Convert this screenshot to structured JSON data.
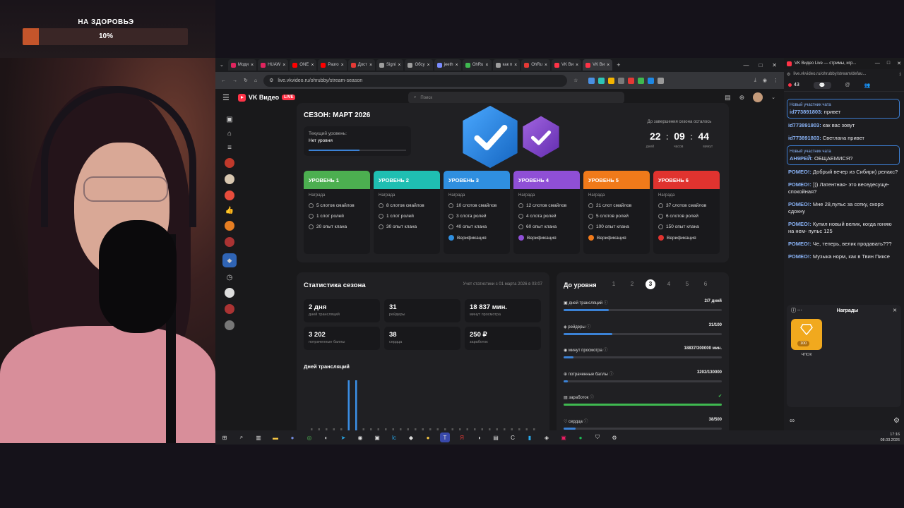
{
  "overlay": {
    "goal_title": "НА ЗДОРОВЬЭ",
    "goal_percent": "10%",
    "goal_progress": 0.1
  },
  "browser": {
    "tabs": [
      {
        "label": "Моди",
        "color": "#e0245e"
      },
      {
        "label": "HUAW",
        "color": "#e0245e"
      },
      {
        "label": "ONE",
        "color": "#ff0000"
      },
      {
        "label": "Разго",
        "color": "#ff0000"
      },
      {
        "label": "Дост",
        "color": "#e53935"
      },
      {
        "label": "Signi",
        "color": "#9e9e9e"
      },
      {
        "label": "Обсу",
        "color": "#9e9e9e"
      },
      {
        "label": "jeeth",
        "color": "#7a8cff"
      },
      {
        "label": "OhRu",
        "color": "#3fb950"
      },
      {
        "label": "как п",
        "color": "#9e9e9e"
      },
      {
        "label": "OhRu",
        "color": "#e53935"
      },
      {
        "label": "VK Ви",
        "color": "#ff3347"
      },
      {
        "label": "VK Ви",
        "color": "#ff3347"
      }
    ],
    "url": "live.vkvideo.ru/ohrubby/stream-season"
  },
  "site": {
    "logo": "VK Видео",
    "live_badge": "LIVE",
    "search_placeholder": "Поиск",
    "season": {
      "title": "СЕЗОН: МАРТ 2026",
      "current_level_label": "Текущий уровень:",
      "current_level_value": "Нет уровня",
      "current_level_progress": 0.52,
      "timer_label": "До завершения сезона осталось",
      "days": "22",
      "hours": "09",
      "minutes": "44",
      "days_unit": "дней",
      "hours_unit": "часов",
      "minutes_unit": "минут",
      "levels": [
        {
          "name": "УРОВЕНЬ 1",
          "color": "#4caf50",
          "reward_label": "Награда",
          "smiles": "5 слотов смайлов",
          "roles": "1 слот ролей",
          "xp": "20 опыт клана",
          "verify": ""
        },
        {
          "name": "УРОВЕНЬ 2",
          "color": "#1fbfb2",
          "reward_label": "Награда",
          "smiles": "8 слотов смайлов",
          "roles": "1 слот ролей",
          "xp": "30 опыт клана",
          "verify": ""
        },
        {
          "name": "УРОВЕНЬ 3",
          "color": "#2f8fe0",
          "reward_label": "Награда",
          "smiles": "10 слотов смайлов",
          "roles": "3 слота ролей",
          "xp": "40 опыт клана",
          "verify": "Верификация",
          "verify_color": "#2f8fe0"
        },
        {
          "name": "УРОВЕНЬ 4",
          "color": "#8f4fd6",
          "reward_label": "Награда",
          "smiles": "12 слотов смайлов",
          "roles": "4 слота ролей",
          "xp": "60 опыт клана",
          "verify": "Верификация",
          "verify_color": "#8f4fd6"
        },
        {
          "name": "УРОВЕНЬ 5",
          "color": "#f07a1a",
          "reward_label": "Награда",
          "smiles": "21 слот смайлов",
          "roles": "5 слотов ролей",
          "xp": "100 опыт клана",
          "verify": "Верификация",
          "verify_color": "#f07a1a"
        },
        {
          "name": "УРОВЕНЬ 6",
          "color": "#e0332f",
          "reward_label": "Награда",
          "smiles": "37 слотов смайлов",
          "roles": "6 слотов ролей",
          "xp": "150 опыт клана",
          "verify": "Верификация",
          "verify_color": "#e0332f"
        }
      ]
    },
    "stats": {
      "title": "Статистика сезона",
      "subtitle": "Учет статистики с 01 марта 2026 в 03:07",
      "tiles": [
        {
          "value": "2 дня",
          "label": "дней трансляций"
        },
        {
          "value": "31",
          "label": "рейдеры"
        },
        {
          "value": "18 837 мин.",
          "label": "минут просмотра"
        },
        {
          "value": "3 202",
          "label": "потраченные баллы"
        },
        {
          "value": "38",
          "label": "сердца"
        },
        {
          "value": "250 ₽",
          "label": "заработок"
        }
      ],
      "days_title": "Дней трансляций"
    },
    "progress": {
      "title": "До уровня",
      "levels": [
        "1",
        "2",
        "3",
        "4",
        "5",
        "6"
      ],
      "selected": "3",
      "rows": [
        {
          "label": "дней трансляций",
          "value": "2/7 дней",
          "fraction": 0.286
        },
        {
          "label": "рейдеры",
          "value": "31/100",
          "fraction": 0.31
        },
        {
          "label": "минут просмотра",
          "value": "18837/300000 мин.",
          "fraction": 0.063
        },
        {
          "label": "потраченные баллы",
          "value": "3202/130000",
          "fraction": 0.025
        },
        {
          "label": "заработок",
          "value": "",
          "fraction": 1.0
        },
        {
          "label": "сердца",
          "value": "38/500",
          "fraction": 0.076
        }
      ]
    }
  },
  "chat": {
    "window_title": "VK Видео Live — стримы, игр...",
    "url": "live.vkvideo.ru/ohrubby/stream/defau...",
    "viewers": "43",
    "messages": [
      {
        "tag": "Новый участник чата",
        "user": "id773891803:",
        "text": "привет",
        "new": true
      },
      {
        "tag": "",
        "user": "id773891803:",
        "text": "как вас зовут",
        "new": false
      },
      {
        "tag": "",
        "user": "id773891803:",
        "text": "Светлана привет",
        "new": false
      },
      {
        "tag": "Новый участник чата",
        "user": "АН9РЕЙ:",
        "text": "ОБЩАЕМИСЯ?",
        "new": true
      },
      {
        "tag": "",
        "user": "РОМЕО!:",
        "text": "Добрый вечер из Сибири) релакс?",
        "new": false
      },
      {
        "tag": "",
        "user": "РОМЕО!:",
        "text": "))) Латентная- это веседесуще- спокойная?",
        "new": false
      },
      {
        "tag": "",
        "user": "РОМЕО!:",
        "text": "Мне 28,пульс за сотку, скоро сдохну",
        "new": false
      },
      {
        "tag": "",
        "user": "РОМЕО!:",
        "text": "Купил новый велик, когда гоняю на нем- пульс 125",
        "new": false
      },
      {
        "tag": "",
        "user": "РОМЕО!:",
        "text": "Че, теперь, велик продавать???",
        "new": false
      },
      {
        "tag": "",
        "user": "РОМЕО!:",
        "text": "Музыка норм, как в Твин Пиксе",
        "new": false
      }
    ],
    "rewards_title": "Награды",
    "reward_cost": "100",
    "reward_name": "ЧПОК"
  },
  "taskbar": {
    "time": "17:16",
    "date": "08.03.2026"
  }
}
